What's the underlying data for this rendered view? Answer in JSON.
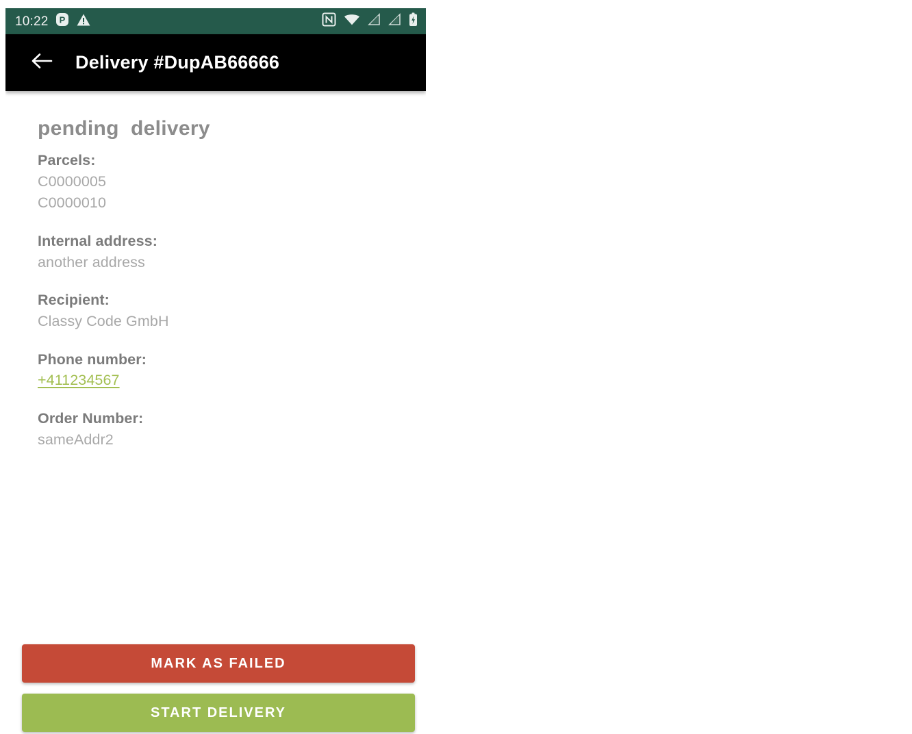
{
  "status_bar": {
    "time": "10:22",
    "background_color": "#255a4b",
    "left_icons": [
      {
        "name": "parking-p-icon",
        "glyph": "P"
      },
      {
        "name": "warning-triangle-icon",
        "glyph": "!"
      }
    ],
    "right_icons": [
      {
        "name": "nfc-icon",
        "label": "N"
      },
      {
        "name": "wifi-icon",
        "label": "wifi"
      },
      {
        "name": "signal-sim1-no-service-icon",
        "label": "signal"
      },
      {
        "name": "signal-sim2-no-service-icon",
        "label": "signal"
      },
      {
        "name": "battery-icon",
        "label": "battery"
      }
    ]
  },
  "app_bar": {
    "background_color": "#000000",
    "back_label": "back",
    "title": "Delivery #DupAB66666"
  },
  "content": {
    "delivery_state": "pending  delivery",
    "fields": [
      {
        "label": "Parcels:",
        "values": [
          "C0000005",
          "C0000010"
        ],
        "type": "text"
      },
      {
        "label": "Internal address:",
        "values": [
          "another address"
        ],
        "type": "text"
      },
      {
        "label": "Recipient:",
        "values": [
          "Classy Code GmbH"
        ],
        "type": "text"
      },
      {
        "label": "Phone number:",
        "values": [
          "+411234567"
        ],
        "type": "link"
      },
      {
        "label": "Order Number:",
        "values": [
          "sameAddr2"
        ],
        "type": "text"
      }
    ]
  },
  "actions": {
    "mark_failed_label": "MARK AS FAILED",
    "mark_failed_color": "#c54a37",
    "start_delivery_label": "START DELIVERY",
    "start_delivery_color": "#9cbb52"
  }
}
